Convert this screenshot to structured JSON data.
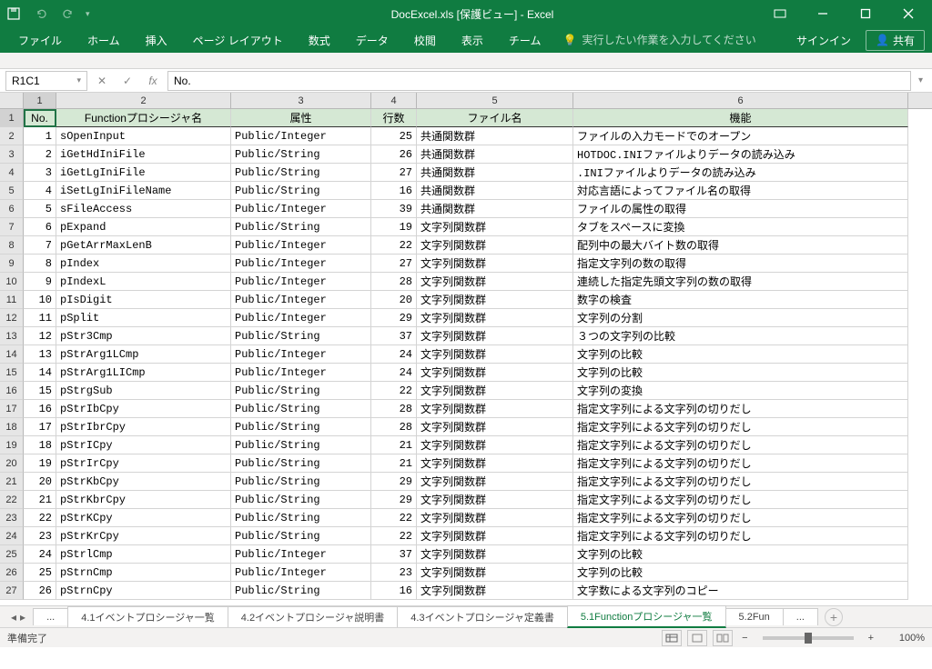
{
  "titlebar": {
    "title": "DocExcel.xls [保護ビュー] - Excel"
  },
  "ribbon": {
    "tabs": [
      "ファイル",
      "ホーム",
      "挿入",
      "ページ レイアウト",
      "数式",
      "データ",
      "校閲",
      "表示",
      "チーム"
    ],
    "tell_me_placeholder": "実行したい作業を入力してください",
    "signin": "サインイン",
    "share": "共有"
  },
  "namebox": "R1C1",
  "formula": "No.",
  "colHeaders": [
    "1",
    "2",
    "3",
    "4",
    "5",
    "6"
  ],
  "tableHeaders": [
    "No.",
    "Functionプロシージャ名",
    "属性",
    "行数",
    "ファイル名",
    "機能"
  ],
  "rows": [
    {
      "n": 1,
      "name": "sOpenInput",
      "attr": "Public/Integer",
      "lines": 25,
      "file": "共通関数群",
      "desc": "ファイルの入力モードでのオープン"
    },
    {
      "n": 2,
      "name": "iGetHdIniFile",
      "attr": "Public/String",
      "lines": 26,
      "file": "共通関数群",
      "desc": "HOTDOC.INIファイルよりデータの読み込み"
    },
    {
      "n": 3,
      "name": "iGetLgIniFile",
      "attr": "Public/String",
      "lines": 27,
      "file": "共通関数群",
      "desc": ".INIファイルよりデータの読み込み"
    },
    {
      "n": 4,
      "name": "iSetLgIniFileName",
      "attr": "Public/String",
      "lines": 16,
      "file": "共通関数群",
      "desc": "対応言語によってファイル名の取得"
    },
    {
      "n": 5,
      "name": "sFileAccess",
      "attr": "Public/Integer",
      "lines": 39,
      "file": "共通関数群",
      "desc": "ファイルの属性の取得"
    },
    {
      "n": 6,
      "name": "pExpand",
      "attr": "Public/String",
      "lines": 19,
      "file": "文字列関数群",
      "desc": "タブをスペースに変換"
    },
    {
      "n": 7,
      "name": "pGetArrMaxLenB",
      "attr": "Public/Integer",
      "lines": 22,
      "file": "文字列関数群",
      "desc": "配列中の最大バイト数の取得"
    },
    {
      "n": 8,
      "name": "pIndex",
      "attr": "Public/Integer",
      "lines": 27,
      "file": "文字列関数群",
      "desc": "指定文字列の数の取得"
    },
    {
      "n": 9,
      "name": "pIndexL",
      "attr": "Public/Integer",
      "lines": 28,
      "file": "文字列関数群",
      "desc": "連続した指定先頭文字列の数の取得"
    },
    {
      "n": 10,
      "name": "pIsDigit",
      "attr": "Public/Integer",
      "lines": 20,
      "file": "文字列関数群",
      "desc": "数字の検査"
    },
    {
      "n": 11,
      "name": "pSplit",
      "attr": "Public/Integer",
      "lines": 29,
      "file": "文字列関数群",
      "desc": "文字列の分割"
    },
    {
      "n": 12,
      "name": "pStr3Cmp",
      "attr": "Public/String",
      "lines": 37,
      "file": "文字列関数群",
      "desc": "３つの文字列の比較"
    },
    {
      "n": 13,
      "name": "pStrArg1LCmp",
      "attr": "Public/Integer",
      "lines": 24,
      "file": "文字列関数群",
      "desc": "文字列の比較"
    },
    {
      "n": 14,
      "name": "pStrArg1LICmp",
      "attr": "Public/Integer",
      "lines": 24,
      "file": "文字列関数群",
      "desc": "文字列の比較"
    },
    {
      "n": 15,
      "name": "pStrgSub",
      "attr": "Public/String",
      "lines": 22,
      "file": "文字列関数群",
      "desc": "文字列の変換"
    },
    {
      "n": 16,
      "name": "pStrIbCpy",
      "attr": "Public/String",
      "lines": 28,
      "file": "文字列関数群",
      "desc": "指定文字列による文字列の切りだし"
    },
    {
      "n": 17,
      "name": "pStrIbrCpy",
      "attr": "Public/String",
      "lines": 28,
      "file": "文字列関数群",
      "desc": "指定文字列による文字列の切りだし"
    },
    {
      "n": 18,
      "name": "pStrICpy",
      "attr": "Public/String",
      "lines": 21,
      "file": "文字列関数群",
      "desc": "指定文字列による文字列の切りだし"
    },
    {
      "n": 19,
      "name": "pStrIrCpy",
      "attr": "Public/String",
      "lines": 21,
      "file": "文字列関数群",
      "desc": "指定文字列による文字列の切りだし"
    },
    {
      "n": 20,
      "name": "pStrKbCpy",
      "attr": "Public/String",
      "lines": 29,
      "file": "文字列関数群",
      "desc": "指定文字列による文字列の切りだし"
    },
    {
      "n": 21,
      "name": "pStrKbrCpy",
      "attr": "Public/String",
      "lines": 29,
      "file": "文字列関数群",
      "desc": "指定文字列による文字列の切りだし"
    },
    {
      "n": 22,
      "name": "pStrKCpy",
      "attr": "Public/String",
      "lines": 22,
      "file": "文字列関数群",
      "desc": "指定文字列による文字列の切りだし"
    },
    {
      "n": 23,
      "name": "pStrKrCpy",
      "attr": "Public/String",
      "lines": 22,
      "file": "文字列関数群",
      "desc": "指定文字列による文字列の切りだし"
    },
    {
      "n": 24,
      "name": "pStrlCmp",
      "attr": "Public/Integer",
      "lines": 37,
      "file": "文字列関数群",
      "desc": "文字列の比較"
    },
    {
      "n": 25,
      "name": "pStrnCmp",
      "attr": "Public/Integer",
      "lines": 23,
      "file": "文字列関数群",
      "desc": "文字列の比較"
    },
    {
      "n": 26,
      "name": "pStrnCpy",
      "attr": "Public/String",
      "lines": 16,
      "file": "文字列関数群",
      "desc": "文字数による文字列のコピー"
    }
  ],
  "sheetTabs": {
    "ellipsis": "...",
    "items": [
      "4.1イベントプロシージャ一覧",
      "4.2イベントプロシージャ説明書",
      "4.3イベントプロシージャ定義書",
      "5.1Functionプロシージャ一覧",
      "5.2Fun"
    ],
    "active": 3,
    "more": "..."
  },
  "statusbar": {
    "ready": "準備完了",
    "zoom": "100%"
  }
}
